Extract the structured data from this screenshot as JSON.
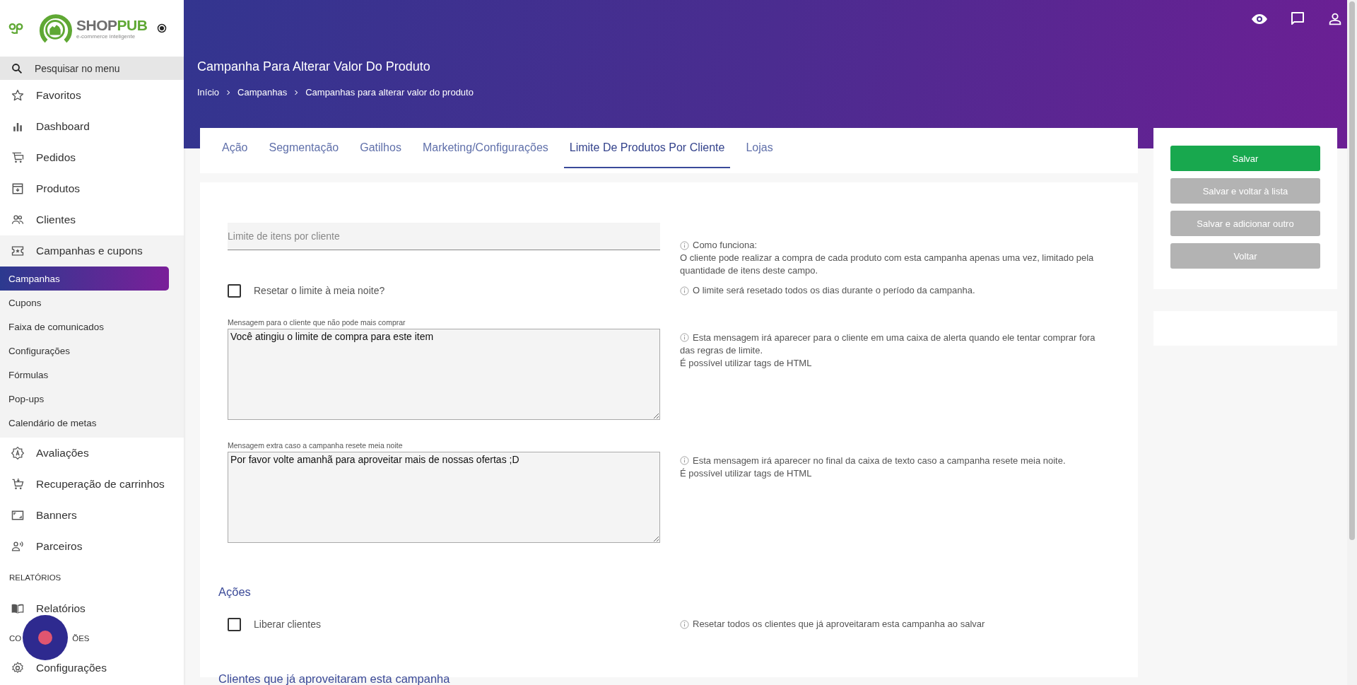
{
  "sidebar": {
    "logo": {
      "name_a": "SHOP",
      "name_b": "PUB",
      "tagline": "e-commerce inteligente"
    },
    "search": {
      "placeholder": "Pesquisar no menu"
    },
    "items": [
      {
        "kind": "item",
        "label": "Favoritos"
      },
      {
        "kind": "item",
        "label": "Dashboard"
      },
      {
        "kind": "item",
        "label": "Pedidos"
      },
      {
        "kind": "item",
        "label": "Produtos"
      },
      {
        "kind": "item",
        "label": "Clientes"
      },
      {
        "kind": "group",
        "label": "Campanhas e cupons",
        "expanded": true,
        "children": [
          {
            "label": "Campanhas",
            "selected": true
          },
          {
            "label": "Cupons",
            "selected": false
          },
          {
            "label": "Faixa de comunicados",
            "selected": false
          },
          {
            "label": "Configurações",
            "selected": false
          },
          {
            "label": "Fórmulas",
            "selected": false
          },
          {
            "label": "Pop-ups",
            "selected": false
          },
          {
            "label": "Calendário de metas",
            "selected": false
          }
        ]
      },
      {
        "kind": "item",
        "label": "Avaliações"
      },
      {
        "kind": "item",
        "label": "Recuperação de carrinhos"
      },
      {
        "kind": "item",
        "label": "Banners"
      },
      {
        "kind": "item",
        "label": "Parceiros"
      },
      {
        "kind": "section",
        "label": "RELATÓRIOS"
      },
      {
        "kind": "item",
        "label": "Relatórios"
      },
      {
        "kind": "section_covered",
        "parts": [
          "CO",
          "ÕES"
        ]
      },
      {
        "kind": "item",
        "label": "Configurações"
      }
    ]
  },
  "header": {
    "title": "Campanha Para Alterar Valor Do Produto",
    "breadcrumb": [
      "Início",
      "Campanhas",
      "Campanhas para alterar valor do produto"
    ]
  },
  "tabs": [
    {
      "label": "Ação",
      "selected": false
    },
    {
      "label": "Segmentação",
      "selected": false
    },
    {
      "label": "Gatilhos",
      "selected": false
    },
    {
      "label": "Marketing/Configurações",
      "selected": false
    },
    {
      "label": "Limite De Produtos Por Cliente",
      "selected": true
    },
    {
      "label": "Lojas",
      "selected": false
    }
  ],
  "form": {
    "limit_field": {
      "placeholder": "Limite de itens por cliente",
      "hint_title": "Como funciona:",
      "hint_text": "O cliente pode realizar a compra de cada produto com esta campanha apenas uma vez, limitado pela quantidade de itens deste campo."
    },
    "reset_checkbox": {
      "label": "Resetar o limite à meia noite?",
      "checked": false,
      "hint": "O limite será resetado todos os dias durante o período da campanha."
    },
    "messages": [
      {
        "label": "Mensagem para o cliente que não pode mais comprar",
        "value": "Você atingiu o limite de compra para este item",
        "hint_lines": [
          "Esta mensagem irá aparecer para o cliente em uma caixa de alerta quando ele tentar comprar fora das regras de limite.",
          "É possível utilizar tags de HTML"
        ]
      },
      {
        "label": "Mensagem extra caso a campanha resete meia noite",
        "value": "Por favor volte amanhã para aproveitar mais de nossas ofertas ;D",
        "hint_lines": [
          "Esta mensagem irá aparecer no final da caixa de texto caso a campanha resete meia noite.",
          "É possível utilizar tags de HTML"
        ]
      }
    ],
    "actions_heading": "Ações",
    "release_checkbox": {
      "label": "Liberar clientes",
      "checked": false,
      "hint": "Resetar todos os clientes que já aproveitaram esta campanha ao salvar"
    },
    "clients_heading": "Clientes que já aproveitaram esta campanha"
  },
  "buttons": [
    {
      "label": "Salvar",
      "kind": "primary"
    },
    {
      "label": "Salvar e voltar à lista",
      "kind": "secondary"
    },
    {
      "label": "Salvar e adicionar outro",
      "kind": "secondary"
    },
    {
      "label": "Voltar",
      "kind": "secondary"
    }
  ]
}
